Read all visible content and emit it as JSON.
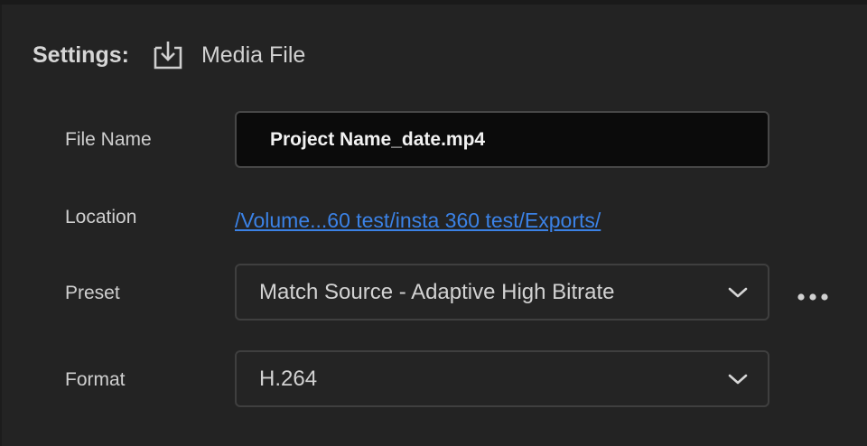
{
  "header": {
    "title": "Settings:",
    "icon": "download-tray-icon",
    "media_label": "Media File"
  },
  "file_name": {
    "label": "File Name",
    "value": "Project Name_date.mp4"
  },
  "location": {
    "label": "Location",
    "path": "/Volume...60 test/insta 360 test/Exports/"
  },
  "preset": {
    "label": "Preset",
    "selected": "Match Source - Adaptive High Bitrate",
    "more_icon": "more-options-icon"
  },
  "format": {
    "label": "Format",
    "selected": "H.264"
  },
  "colors": {
    "background": "#232323",
    "link": "#3b82e6",
    "input_background": "#0b0b0b"
  }
}
